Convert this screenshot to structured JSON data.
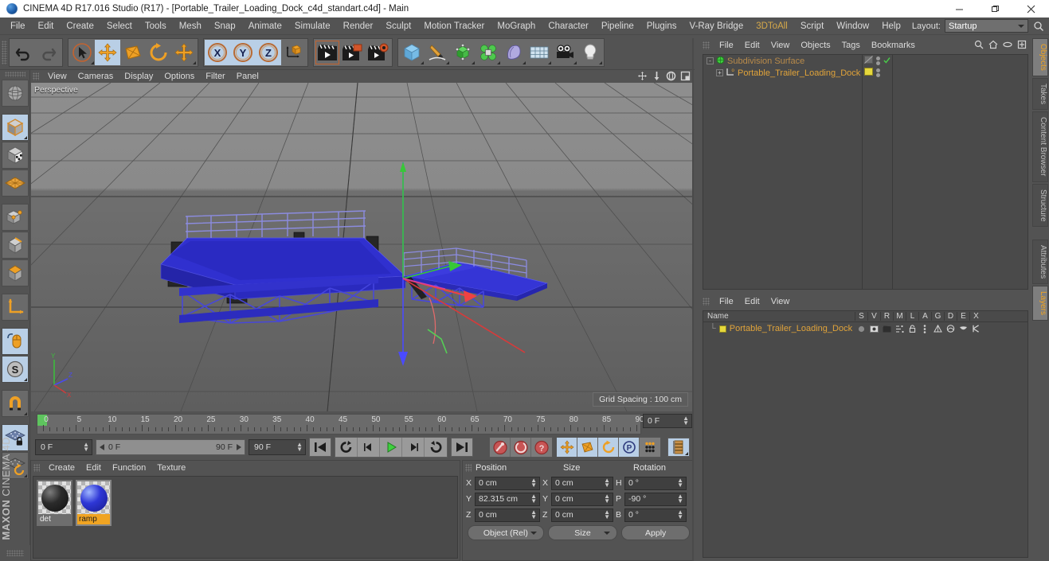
{
  "window": {
    "title": "CINEMA 4D R17.016 Studio (R17) - [Portable_Trailer_Loading_Dock_c4d_standart.c4d] - Main",
    "minimize": "–",
    "maximize": "❐",
    "close": "✕"
  },
  "menubar": {
    "items": [
      {
        "label": "File"
      },
      {
        "label": "Edit"
      },
      {
        "label": "Create"
      },
      {
        "label": "Select"
      },
      {
        "label": "Tools"
      },
      {
        "label": "Mesh"
      },
      {
        "label": "Snap"
      },
      {
        "label": "Animate"
      },
      {
        "label": "Simulate"
      },
      {
        "label": "Render"
      },
      {
        "label": "Sculpt"
      },
      {
        "label": "Motion Tracker"
      },
      {
        "label": "MoGraph"
      },
      {
        "label": "Character"
      },
      {
        "label": "Pipeline"
      },
      {
        "label": "Plugins"
      },
      {
        "label": "V-Ray Bridge"
      },
      {
        "label": "3DToAll",
        "accent": true
      },
      {
        "label": "Script"
      },
      {
        "label": "Window"
      },
      {
        "label": "Help"
      }
    ],
    "layout_label": "Layout:",
    "layout_value": "Startup",
    "search_icon": "search-icon"
  },
  "toolbar": {
    "groups": [
      {
        "name": "history",
        "buttons": [
          {
            "name": "undo-button",
            "icon": "undo-arrow-icon",
            "state": "off"
          },
          {
            "name": "redo-button",
            "icon": "redo-arrow-icon",
            "state": "disabled"
          }
        ]
      },
      {
        "name": "transform-tools",
        "buttons": [
          {
            "name": "live-selection-tool",
            "icon": "cursor-select-icon",
            "state": "off"
          },
          {
            "name": "move-tool",
            "icon": "move-arrows-icon",
            "state": "on"
          },
          {
            "name": "scale-tool",
            "icon": "scale-box-icon",
            "state": "off"
          },
          {
            "name": "rotate-tool",
            "icon": "rotate-circle-icon",
            "state": "off"
          },
          {
            "name": "transform-tool",
            "icon": "move-arrows-icon",
            "state": "off"
          }
        ]
      },
      {
        "name": "axis-locks",
        "buttons": [
          {
            "name": "x-axis-lock",
            "icon": "x-axis-icon",
            "state": "on",
            "label": "X"
          },
          {
            "name": "y-axis-lock",
            "icon": "y-axis-icon",
            "state": "on",
            "label": "Y"
          },
          {
            "name": "z-axis-lock",
            "icon": "z-axis-icon",
            "state": "on",
            "label": "Z"
          },
          {
            "name": "world-object-coordinate-toggle",
            "icon": "coordinate-cube-icon",
            "state": "off"
          }
        ]
      },
      {
        "name": "render-tools",
        "buttons": [
          {
            "name": "render-view-button",
            "icon": "clapperboard-icon",
            "state": "active"
          },
          {
            "name": "render-to-picture-viewer-button",
            "icon": "clapperboard-picture-icon",
            "state": "off"
          },
          {
            "name": "render-settings-button",
            "icon": "clapperboard-gear-icon",
            "state": "off"
          }
        ]
      },
      {
        "name": "create-objects",
        "buttons": [
          {
            "name": "add-cube-button",
            "icon": "blue-cube-icon",
            "state": "off"
          },
          {
            "name": "add-spline-button",
            "icon": "pen-spline-icon",
            "state": "off"
          },
          {
            "name": "add-generator-button",
            "icon": "green-cube-generator-icon",
            "state": "off"
          },
          {
            "name": "add-mograph-button",
            "icon": "mograph-cluster-icon",
            "state": "off"
          },
          {
            "name": "add-deformer-button",
            "icon": "bend-deformer-icon",
            "state": "off"
          },
          {
            "name": "add-scene-object-button",
            "icon": "floor-grid-icon",
            "state": "off"
          },
          {
            "name": "add-camera-button",
            "icon": "camera-icon",
            "state": "off"
          },
          {
            "name": "add-light-button",
            "icon": "lightbulb-icon",
            "state": "off"
          }
        ]
      }
    ]
  },
  "lefttoolbar": {
    "buttons": [
      {
        "name": "undo-view-button",
        "icon": "globe-sphere-icon",
        "state": "off"
      },
      {
        "name": "model-mode-button",
        "icon": "model-cube-icon",
        "state": "on"
      },
      {
        "name": "texture-mode-button",
        "icon": "texture-checker-cube-icon",
        "state": "off"
      },
      {
        "name": "polygon-mode-button",
        "icon": "polygon-mesh-icon",
        "state": "off"
      },
      {
        "name": "point-mode-button",
        "icon": "point-cube-icon",
        "state": "off"
      },
      {
        "name": "edge-mode-button",
        "icon": "edge-cube-icon",
        "state": "off"
      },
      {
        "name": "face-mode-button",
        "icon": "face-cube-icon",
        "state": "off"
      },
      {
        "name": "axis-mode-button",
        "icon": "axis-l-icon",
        "state": "off"
      },
      {
        "name": "viewport-solo-button",
        "icon": "mouse-icon",
        "state": "on"
      },
      {
        "name": "snap-settings-button",
        "icon": "s-circle-icon",
        "state": "on"
      },
      {
        "name": "magnet-tool-button",
        "icon": "magnet-icon",
        "state": "off"
      },
      {
        "name": "workplane-lock-button",
        "icon": "workplane-lock-icon",
        "state": "on"
      },
      {
        "name": "workplane-rotate-button",
        "icon": "workplane-rotate-icon",
        "state": "off"
      }
    ],
    "brand_bold": "MAXON",
    "brand_light": "CINEMA 4D"
  },
  "viewport": {
    "menu": [
      {
        "label": "View"
      },
      {
        "label": "Cameras"
      },
      {
        "label": "Display"
      },
      {
        "label": "Options"
      },
      {
        "label": "Filter"
      },
      {
        "label": "Panel"
      }
    ],
    "view_label": "Perspective",
    "grid_spacing": "Grid Spacing : 100 cm",
    "icons": [
      {
        "name": "pan-view-icon"
      },
      {
        "name": "dolly-view-icon"
      },
      {
        "name": "rotate-view-icon"
      },
      {
        "name": "maximize-view-icon"
      }
    ],
    "axis_gizmo": {
      "x": "X",
      "y": "Y",
      "z": "Z"
    },
    "model_color": "#2f2fd8",
    "leg_color": "#2a2a2a"
  },
  "timeline": {
    "ticks": [
      0,
      5,
      10,
      15,
      20,
      25,
      30,
      35,
      40,
      45,
      50,
      55,
      60,
      65,
      70,
      75,
      80,
      85,
      90
    ],
    "end_field": "0 F",
    "current_frame": "0 F",
    "range_start": "0 F",
    "range_end": "90 F",
    "max_frame": "90 F",
    "transport": [
      {
        "name": "go-to-start-button",
        "icon": "skip-start-icon"
      },
      {
        "name": "play-backwards-button",
        "icon": "reverse-loop-icon"
      },
      {
        "name": "previous-frame-button",
        "icon": "step-back-icon"
      },
      {
        "name": "play-button",
        "icon": "play-icon"
      },
      {
        "name": "next-frame-button",
        "icon": "step-forward-icon"
      },
      {
        "name": "play-forwards-loop-button",
        "icon": "forward-loop-icon"
      },
      {
        "name": "go-to-end-button",
        "icon": "skip-end-icon"
      }
    ],
    "keyframe_tools": [
      {
        "name": "record-active-objects-button",
        "icon": "record-key-icon"
      },
      {
        "name": "autokeying-button",
        "icon": "auto-key-icon"
      },
      {
        "name": "keyframe-selection-button",
        "icon": "key-question-icon"
      }
    ],
    "key_toggles": [
      {
        "name": "position-key-toggle",
        "icon": "move-arrows-icon",
        "state": "on"
      },
      {
        "name": "scale-key-toggle",
        "icon": "scale-box-icon",
        "state": "on"
      },
      {
        "name": "rotation-key-toggle",
        "icon": "rotate-circle-icon",
        "state": "on"
      },
      {
        "name": "parameter-key-toggle",
        "icon": "p-circle-icon",
        "state": "on"
      },
      {
        "name": "point-level-animation-toggle",
        "icon": "pla-dots-icon",
        "state": "off"
      }
    ],
    "timeline_view_button": {
      "name": "timeline-window-button",
      "icon": "timeline-bars-icon"
    }
  },
  "materials": {
    "menu": [
      {
        "label": "Create"
      },
      {
        "label": "Edit"
      },
      {
        "label": "Function"
      },
      {
        "label": "Texture"
      }
    ],
    "items": [
      {
        "name": "det",
        "color": "black",
        "selected": false
      },
      {
        "name": "ramp",
        "color": "blue",
        "selected": true
      }
    ]
  },
  "coordinates": {
    "headers": [
      "Position",
      "Size",
      "Rotation"
    ],
    "rows": [
      {
        "pos_axis": "X",
        "pos_value": "0 cm",
        "size_axis": "X",
        "size_value": "0 cm",
        "rot_axis": "H",
        "rot_value": "0 °"
      },
      {
        "pos_axis": "Y",
        "pos_value": "82.315 cm",
        "size_axis": "Y",
        "size_value": "0 cm",
        "rot_axis": "P",
        "rot_value": "-90 °"
      },
      {
        "pos_axis": "Z",
        "pos_value": "0 cm",
        "size_axis": "Z",
        "size_value": "0 cm",
        "rot_axis": "B",
        "rot_value": "0 °"
      }
    ],
    "object_mode": "Object (Rel)",
    "size_mode": "Size",
    "apply_label": "Apply"
  },
  "object_manager": {
    "menu": [
      {
        "label": "File"
      },
      {
        "label": "Edit"
      },
      {
        "label": "View"
      },
      {
        "label": "Objects"
      },
      {
        "label": "Tags"
      },
      {
        "label": "Bookmarks"
      }
    ],
    "icons": [
      {
        "name": "search-icon"
      },
      {
        "name": "home-icon"
      },
      {
        "name": "link-icon"
      },
      {
        "name": "fit-icon"
      }
    ],
    "tree": [
      {
        "label": "Subdivision Surface",
        "type": "generator",
        "level": 0,
        "expander": "-",
        "visible": true
      },
      {
        "label": "Portable_Trailer_Loading_Dock",
        "type": "polygon",
        "level": 1,
        "expander": "+",
        "visible": true
      }
    ]
  },
  "layer_manager": {
    "menu": [
      {
        "label": "File"
      },
      {
        "label": "Edit"
      },
      {
        "label": "View"
      }
    ],
    "columns": [
      "Name",
      "S",
      "V",
      "R",
      "M",
      "L",
      "A",
      "G",
      "D",
      "E",
      "X"
    ],
    "rows": [
      {
        "name": "Portable_Trailer_Loading_Dock",
        "swatch": "#e6d83c"
      }
    ]
  },
  "right_tabs": {
    "upper": [
      {
        "label": "Objects",
        "active": true
      },
      {
        "label": "Takes",
        "active": false
      },
      {
        "label": "Content Browser",
        "active": false
      },
      {
        "label": "Structure",
        "active": false
      }
    ],
    "lower": [
      {
        "label": "Attributes",
        "active": false
      },
      {
        "label": "Layers",
        "active": true
      }
    ]
  }
}
